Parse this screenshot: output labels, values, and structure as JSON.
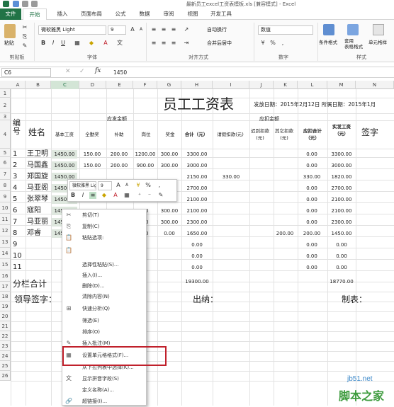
{
  "window": {
    "title": "最新员工excel工资表模板.xls  [兼容模式] - Excel"
  },
  "tabs": [
    "文件",
    "开始",
    "插入",
    "页面布局",
    "公式",
    "数据",
    "审阅",
    "视图",
    "开发工具"
  ],
  "ribbon": {
    "paste_label": "粘贴",
    "clipboard_label": "剪贴板",
    "font_group_label": "字体",
    "align_group_label": "对齐方式",
    "number_group_label": "数字",
    "styles_group_label": "样式",
    "font_name": "微软雅黑 Light",
    "font_size": "9",
    "wrap_text": "自动换行",
    "merge_center": "合并后居中",
    "number_format": "数值",
    "cond_format": "条件格式",
    "table_format": "套用\n表格格式",
    "cell_styles": "单元格样"
  },
  "formula_bar": {
    "name_box": "C6",
    "fx": "fx",
    "value": "1450"
  },
  "columns": [
    "A",
    "B",
    "C",
    "D",
    "E",
    "F",
    "G",
    "H",
    "I",
    "J",
    "K",
    "L",
    "M",
    "N"
  ],
  "rows": [
    "1",
    "2",
    "3",
    "4",
    "5",
    "6",
    "7",
    "8",
    "9",
    "10",
    "11",
    "12",
    "13",
    "14",
    "15",
    "16",
    "17",
    "18",
    "19",
    "20",
    "21",
    "22",
    "23",
    "24",
    "25",
    "26"
  ],
  "sheet": {
    "title": "员工工资表",
    "date_label": "发放日期：2015年2月12日  所属日期：2015年1月",
    "header": {
      "num": "编号",
      "name": "姓名",
      "payable": "应发金额",
      "deduct": "应扣金额",
      "base": "基本工资",
      "full_att": "全勤奖",
      "subsidy": "补助",
      "post": "岗位",
      "bonus": "奖金",
      "total": "合计（元）",
      "leave": "请假扣款(元)",
      "late": "迟到扣款(元)",
      "other": "其它扣款(元)",
      "deduct_total": "应扣合计（元）",
      "actual": "实发工资（元）",
      "sign": "签字"
    },
    "data_rows": [
      {
        "no": "1",
        "name": "王卫明",
        "base": "1450.00",
        "full": "150.00",
        "sub": "200.00",
        "post": "1200.00",
        "bonus": "300.00",
        "total": "3300.00",
        "leave": "",
        "late": "",
        "other": "",
        "dtotal": "0.00",
        "actual": "3300.00"
      },
      {
        "no": "2",
        "name": "马国鑫",
        "base": "1450.00",
        "full": "150.00",
        "sub": "200.00",
        "post": "900.00",
        "bonus": "300.00",
        "total": "3000.00",
        "leave": "",
        "late": "",
        "other": "",
        "dtotal": "0.00",
        "actual": "3000.00"
      },
      {
        "no": "3",
        "name": "郑国旋",
        "base": "1450.00",
        "full": "",
        "sub": "",
        "post": "",
        "bonus": "",
        "total": "2150.00",
        "leave": "330.00",
        "late": "",
        "other": "",
        "dtotal": "330.00",
        "actual": "1820.00"
      },
      {
        "no": "4",
        "name": "马亚阁",
        "base": "1450.00",
        "full": "",
        "sub": "",
        "post": "",
        "bonus": "",
        "total": "2700.00",
        "leave": "",
        "late": "",
        "other": "",
        "dtotal": "0.00",
        "actual": "2700.00"
      },
      {
        "no": "5",
        "name": "张翠琴",
        "base": "1450.00",
        "full": "",
        "sub": "",
        "post": "",
        "bonus": "",
        "total": "2100.00",
        "leave": "",
        "late": "",
        "other": "",
        "dtotal": "0.00",
        "actual": "2100.00"
      },
      {
        "no": "6",
        "name": "寇阳",
        "base": "1450.00",
        "full": "",
        "sub": "",
        "post": "00",
        "bonus": "300.00",
        "total": "2100.00",
        "leave": "",
        "late": "",
        "other": "",
        "dtotal": "0.00",
        "actual": "2100.00"
      },
      {
        "no": "7",
        "name": "马亚丽",
        "base": "1450.00",
        "full": "",
        "sub": "",
        "post": "00",
        "bonus": "300.00",
        "total": "2300.00",
        "leave": "",
        "late": "",
        "other": "",
        "dtotal": "0.00",
        "actual": "2300.00"
      },
      {
        "no": "8",
        "name": "邓睿",
        "base": "1450.00",
        "full": "",
        "sub": "",
        "post": "00",
        "bonus": "0.00",
        "total": "1650.00",
        "leave": "",
        "late": "",
        "other": "200.00",
        "dtotal": "200.00",
        "actual": "1450.00"
      },
      {
        "no": "9",
        "name": "",
        "base": "",
        "full": "",
        "sub": "",
        "post": "",
        "bonus": "",
        "total": "0.00",
        "leave": "",
        "late": "",
        "other": "",
        "dtotal": "0.00",
        "actual": "0.00"
      },
      {
        "no": "10",
        "name": "",
        "base": "",
        "full": "",
        "sub": "",
        "post": "",
        "bonus": "",
        "total": "0.00",
        "leave": "",
        "late": "",
        "other": "",
        "dtotal": "0.00",
        "actual": "0.00"
      },
      {
        "no": "11",
        "name": "",
        "base": "",
        "full": "",
        "sub": "",
        "post": "",
        "bonus": "",
        "total": "0.00",
        "leave": "",
        "late": "",
        "other": "",
        "dtotal": "0.00",
        "actual": "0.00"
      }
    ],
    "subtotal_label": "分栏合计",
    "subtotal_total": "19300.00",
    "subtotal_actual": "18770.00",
    "leader_sign": "领导签字：",
    "cashier": "出纳：",
    "maker": "制表："
  },
  "mini_toolbar": {
    "font": "微软雅黑 Light",
    "size": "9"
  },
  "context_menu": [
    {
      "label": "剪切(T)",
      "icon": "✂"
    },
    {
      "label": "复制(C)",
      "icon": "⎘"
    },
    {
      "label": "粘贴选项:",
      "icon": "📋"
    },
    {
      "label": "",
      "icon": "📋"
    },
    {
      "label": "选择性粘贴(S)...",
      "icon": ""
    },
    {
      "label": "插入(I)...",
      "icon": ""
    },
    {
      "label": "删除(D)...",
      "icon": ""
    },
    {
      "label": "清除内容(N)",
      "icon": ""
    },
    {
      "label": "快速分析(Q)",
      "icon": "⊞"
    },
    {
      "label": "筛选(E)",
      "icon": ""
    },
    {
      "label": "排序(O)",
      "icon": ""
    },
    {
      "label": "插入批注(M)",
      "icon": "✎"
    },
    {
      "label": "设置单元格格式(F)...",
      "icon": "▦"
    },
    {
      "label": "从下拉列表中选择(K)...",
      "icon": ""
    },
    {
      "label": "显示拼音字段(S)",
      "icon": "文"
    },
    {
      "label": "定义名称(A)...",
      "icon": ""
    },
    {
      "label": "超链接(I)...",
      "icon": "🔗"
    }
  ],
  "watermark": {
    "site": "jb51.net",
    "brand": "脚本之家"
  }
}
